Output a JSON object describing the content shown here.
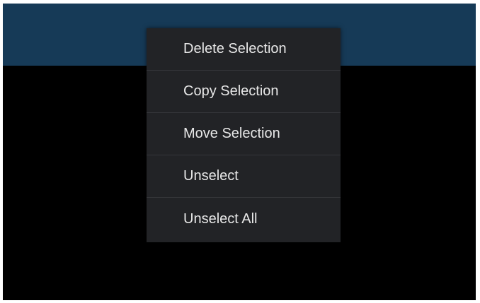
{
  "context_menu": {
    "items": [
      {
        "label": "Delete Selection"
      },
      {
        "label": "Copy Selection"
      },
      {
        "label": "Move Selection"
      },
      {
        "label": "Unselect"
      },
      {
        "label": "Unselect All"
      }
    ]
  },
  "colors": {
    "action_bar": "#163a57",
    "background": "#000000",
    "menu_background": "#222326",
    "menu_divider": "#35363a",
    "menu_text": "#e8e8e8"
  }
}
